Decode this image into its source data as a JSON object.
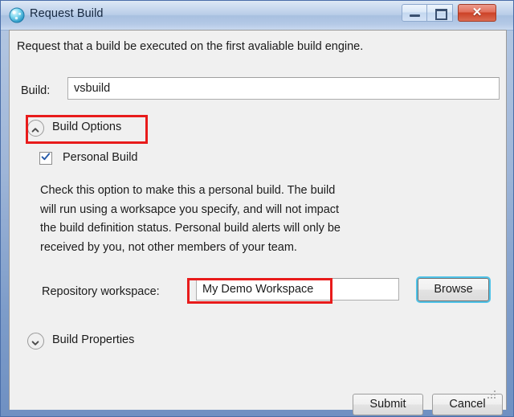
{
  "window": {
    "title": "Request Build",
    "icon": "build-sphere-icon",
    "controls": {
      "minimize": "minimize-button",
      "maximize": "maximize-button",
      "close_glyph": "✕"
    }
  },
  "content": {
    "instruction": "Request that a build be executed on the first avaliable build engine.",
    "build": {
      "label": "Build:",
      "value": "vsbuild",
      "placeholder": ""
    },
    "build_options": {
      "header": "Build Options",
      "expanded": true,
      "chevron": "chevron-up-icon",
      "personal_build": {
        "label": "Personal Build",
        "checked": true
      },
      "description": "Check this option to make this a personal build. The build will run using a worksapce you specify, and will not impact the build definition status. Personal build alerts will only be received by you, not other members of your team.",
      "repository_workspace": {
        "label": "Repository workspace:",
        "value": "My Demo Workspace",
        "placeholder": "",
        "browse_label": "Browse"
      }
    },
    "build_properties": {
      "header": "Build Properties",
      "expanded": false,
      "chevron": "chevron-down-icon"
    }
  },
  "footer": {
    "submit_label": "Submit",
    "cancel_label": "Cancel"
  },
  "annotations": {
    "personal_build_highlight": "red-highlight-box",
    "workspace_highlight": "red-highlight-box",
    "color": "#e81b1b"
  }
}
